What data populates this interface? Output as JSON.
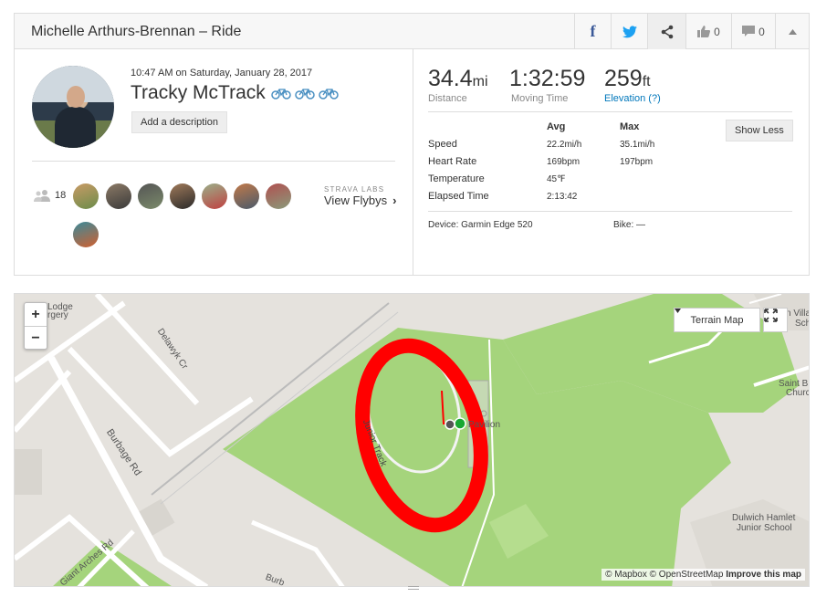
{
  "header": {
    "title": "Michelle Arthurs-Brennan – Ride",
    "kudos_count": "0",
    "comment_count": "0"
  },
  "activity": {
    "datetime": "10:47 AM on Saturday, January 28, 2017",
    "name": "Tracky McTrack",
    "add_description_label": "Add a description",
    "group_count": "18",
    "labs_label": "STRAVA LABS",
    "flybys_label": "View Flybys"
  },
  "stats": {
    "distance": {
      "value": "34.4",
      "unit": "mi",
      "label": "Distance"
    },
    "moving_time": {
      "value": "1:32:59",
      "label": "Moving Time"
    },
    "elevation": {
      "value": "259",
      "unit": "ft",
      "label": "Elevation (?)"
    },
    "col_avg": "Avg",
    "col_max": "Max",
    "show_less_label": "Show Less",
    "rows": [
      {
        "label": "Speed",
        "avg": "22.2mi/h",
        "max": "35.1mi/h"
      },
      {
        "label": "Heart Rate",
        "avg": "169bpm",
        "max": "197bpm"
      },
      {
        "label": "Temperature",
        "avg": "45℉",
        "max": ""
      },
      {
        "label": "Elapsed Time",
        "avg": "2:13:42",
        "max": ""
      }
    ],
    "device": "Device: Garmin Edge 520",
    "bike": "Bike: —"
  },
  "map": {
    "terrain_label": "Terrain Map",
    "attribution_mapbox": "© Mapbox",
    "attribution_osm": "© OpenStreetMap",
    "attribution_improve": "Improve this map",
    "labels": {
      "delawyk": "Delawyk Cr",
      "burbage1": "Burbage Rd",
      "burbage2": "Burb",
      "junior_track": "Junior Track",
      "pavilion": "Pavilion",
      "lodge": "Lodge",
      "surgery": "rgery",
      "giant_arches": "Giant Arches Rd",
      "saint_b": "Saint B",
      "church": "Churc",
      "villa": "n Villa",
      "sch": "Sch",
      "dulwich1": "Dulwich Hamlet",
      "dulwich2": "Junior School"
    }
  },
  "colors": {
    "route": "#ff0000",
    "grass": "#a5d47c",
    "link": "#0077bb",
    "facebook": "#3b5998",
    "twitter": "#1da1f2"
  }
}
